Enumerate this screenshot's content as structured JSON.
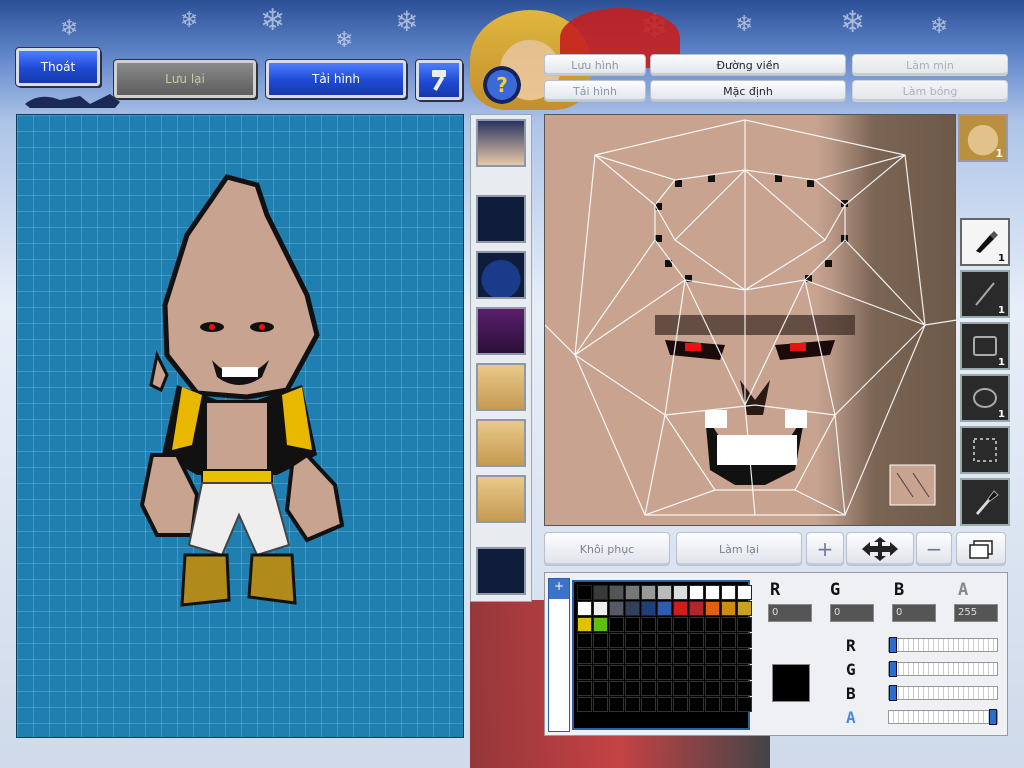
{
  "toolbar": {
    "exit_label": "Thoát",
    "save_label": "Lưu lại",
    "download_label": "Tải hình"
  },
  "editor_tabs": {
    "save_image": "Lưu hình",
    "load_image": "Tải hình",
    "outline": "Đường viền",
    "default": "Mặc định",
    "smooth": "Làm mịn",
    "shade": "Làm bóng"
  },
  "actions": {
    "restore": "Khôi phục",
    "redo": "Làm lại"
  },
  "tools": [
    {
      "icon": "brush-icon",
      "count": "1"
    },
    {
      "icon": "line-icon",
      "count": "1"
    },
    {
      "icon": "rectangle-icon",
      "count": "1"
    },
    {
      "icon": "ellipse-icon",
      "count": "1"
    },
    {
      "icon": "selection-icon",
      "count": ""
    },
    {
      "icon": "eyedropper-icon",
      "count": ""
    }
  ],
  "face_thumb_count": "1",
  "color": {
    "channels": {
      "r": "R",
      "g": "G",
      "b": "B",
      "a": "A"
    },
    "values": {
      "r": "0",
      "g": "0",
      "b": "0",
      "a": "255"
    },
    "current": "#000000",
    "palette_top": [
      "#000000",
      "#3a3a3a",
      "#555555",
      "#777777",
      "#999999",
      "#bbbbbb",
      "#dddddd",
      "#ffffff",
      "#ffffff",
      "#ffffff",
      "#ffffff",
      "#ffffff",
      "#eeeeee",
      "#555a66",
      "#33405c",
      "#1f3f7a",
      "#2a5cb0",
      "#d11c1c",
      "#b2262b",
      "#e06010",
      "#d08a10",
      "#c9a020",
      "#e0c000",
      "#60c010",
      "#000000",
      "#000000",
      "#000000",
      "#000000",
      "#000000",
      "#000000",
      "#000000",
      "#000000",
      "#000000"
    ],
    "slider_levels": {
      "r": 0,
      "g": 0,
      "b": 0,
      "a": 1.0
    }
  },
  "colors": {
    "grid_bg": "#1f7fb0",
    "accent_blue": "#1f49d4",
    "skin": "#c7a390"
  }
}
